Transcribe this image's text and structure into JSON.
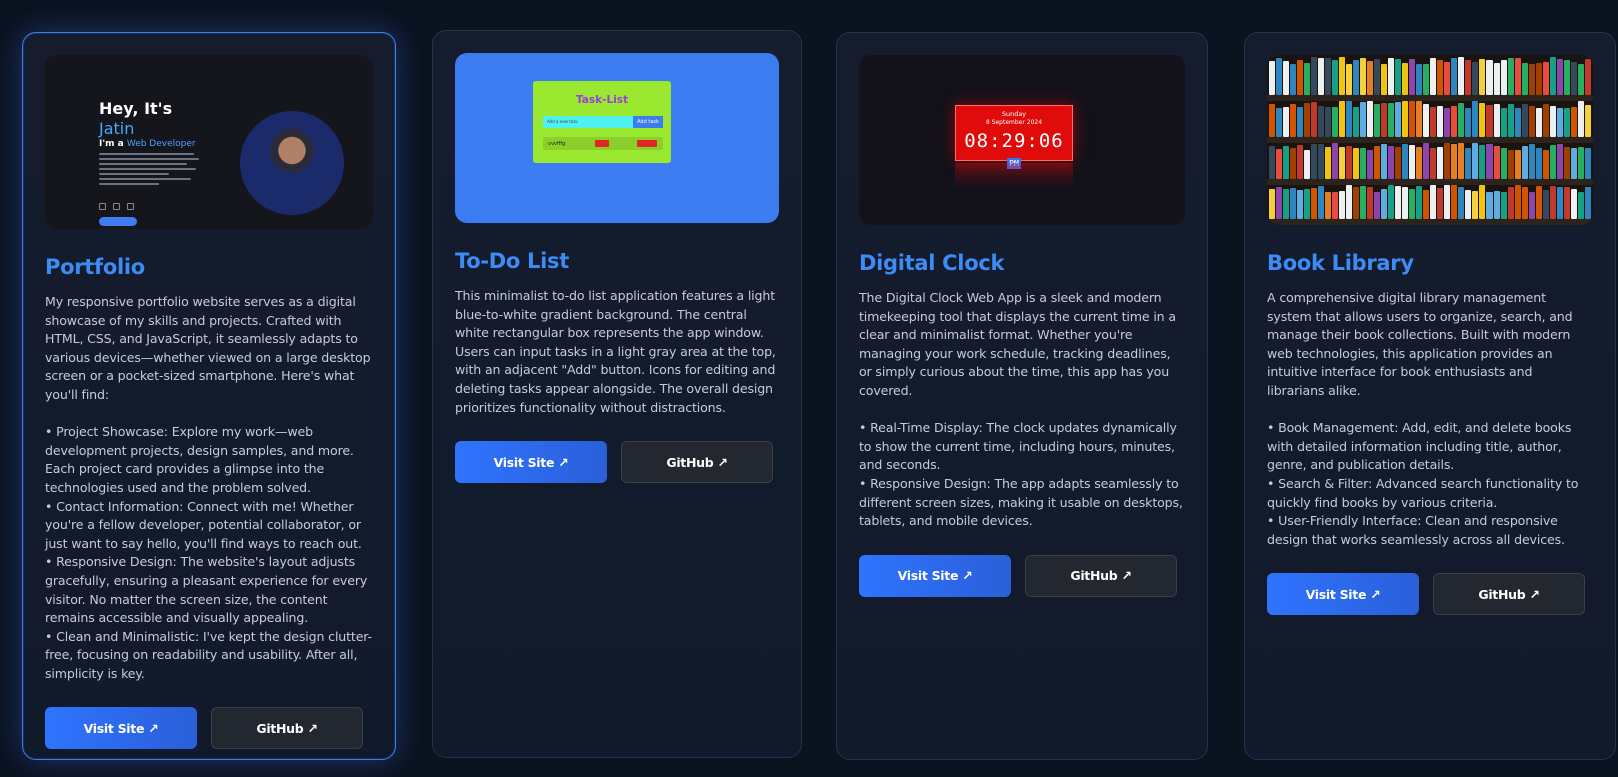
{
  "cards": [
    {
      "title": "Portfolio",
      "description": "My responsive portfolio website serves as a digital showcase of my skills and projects. Crafted with HTML, CSS, and JavaScript, it seamlessly adapts to various devices—whether viewed on a large desktop screen or a pocket-sized smartphone. Here's what you'll find:\n\n• Project Showcase: Explore my work—web development projects, design samples, and more. Each project card provides a glimpse into the technologies used and the problem solved.\n• Contact Information: Connect with me! Whether you're a fellow developer, potential collaborator, or just want to say hello, you'll find ways to reach out.\n• Responsive Design: The website's layout adjusts gracefully, ensuring a pleasant experience for every visitor. No matter the screen size, the content remains accessible and visually appealing.\n• Clean and Minimalistic: I've kept the design clutter-free, focusing on readability and usability. After all, simplicity is key.",
      "visit_label": "Visit Site ↗",
      "github_label": "GitHub ↗",
      "thumb": {
        "hey": "Hey, It's",
        "name": "Jatin",
        "role_prefix": "I'm a ",
        "role": "Web Developer"
      }
    },
    {
      "title": "To-Do List",
      "description": "This minimalist to-do list application features a light blue-to-white gradient background. The central white rectangular box represents the app window. Users can input tasks in a light gray area at the top, with an adjacent \"Add\" button. Icons for editing and deleting tasks appear alongside. The overall design prioritizes functionality without distractions.",
      "visit_label": "Visit Site ↗",
      "github_label": "GitHub ↗",
      "thumb": {
        "title": "Task-List",
        "input_placeholder": "Add a new task",
        "add_label": "Add task",
        "task": "vvvfffg",
        "edit_label": "Edit",
        "delete_label": "Delete"
      }
    },
    {
      "title": "Digital Clock",
      "description": "The Digital Clock Web App is a sleek and modern timekeeping tool that displays the current time in a clear and minimalist format. Whether you're managing your work schedule, tracking deadlines, or simply curious about the time, this app has you covered.\n\n• Real-Time Display: The clock updates dynamically to show the current time, including hours, minutes, and seconds.\n• Responsive Design: The app adapts seamlessly to different screen sizes, making it usable on desktops, tablets, and mobile devices.",
      "visit_label": "Visit Site ↗",
      "github_label": "GitHub ↗",
      "thumb": {
        "day": "Sunday",
        "date": "8 September 2024",
        "time": "08:29:06",
        "period": "PM"
      }
    },
    {
      "title": "Book Library",
      "description": "A comprehensive digital library management system that allows users to organize, search, and manage their book collections. Built with modern web technologies, this application provides an intuitive interface for book enthusiasts and librarians alike.\n\n• Book Management: Add, edit, and delete books with detailed information including title, author, genre, and publication details.\n• Search & Filter: Advanced search functionality to quickly find books by various criteria.\n• User-Friendly Interface: Clean and responsive design that works seamlessly across all devices.",
      "visit_label": "Visit Site ↗",
      "github_label": "GitHub ↗"
    }
  ],
  "colors": {
    "accent": "#3d8bf5",
    "background": "#0b1220",
    "card_bg": "#141c2e",
    "button_primary": "#2f74ff",
    "button_secondary": "#23272f"
  }
}
